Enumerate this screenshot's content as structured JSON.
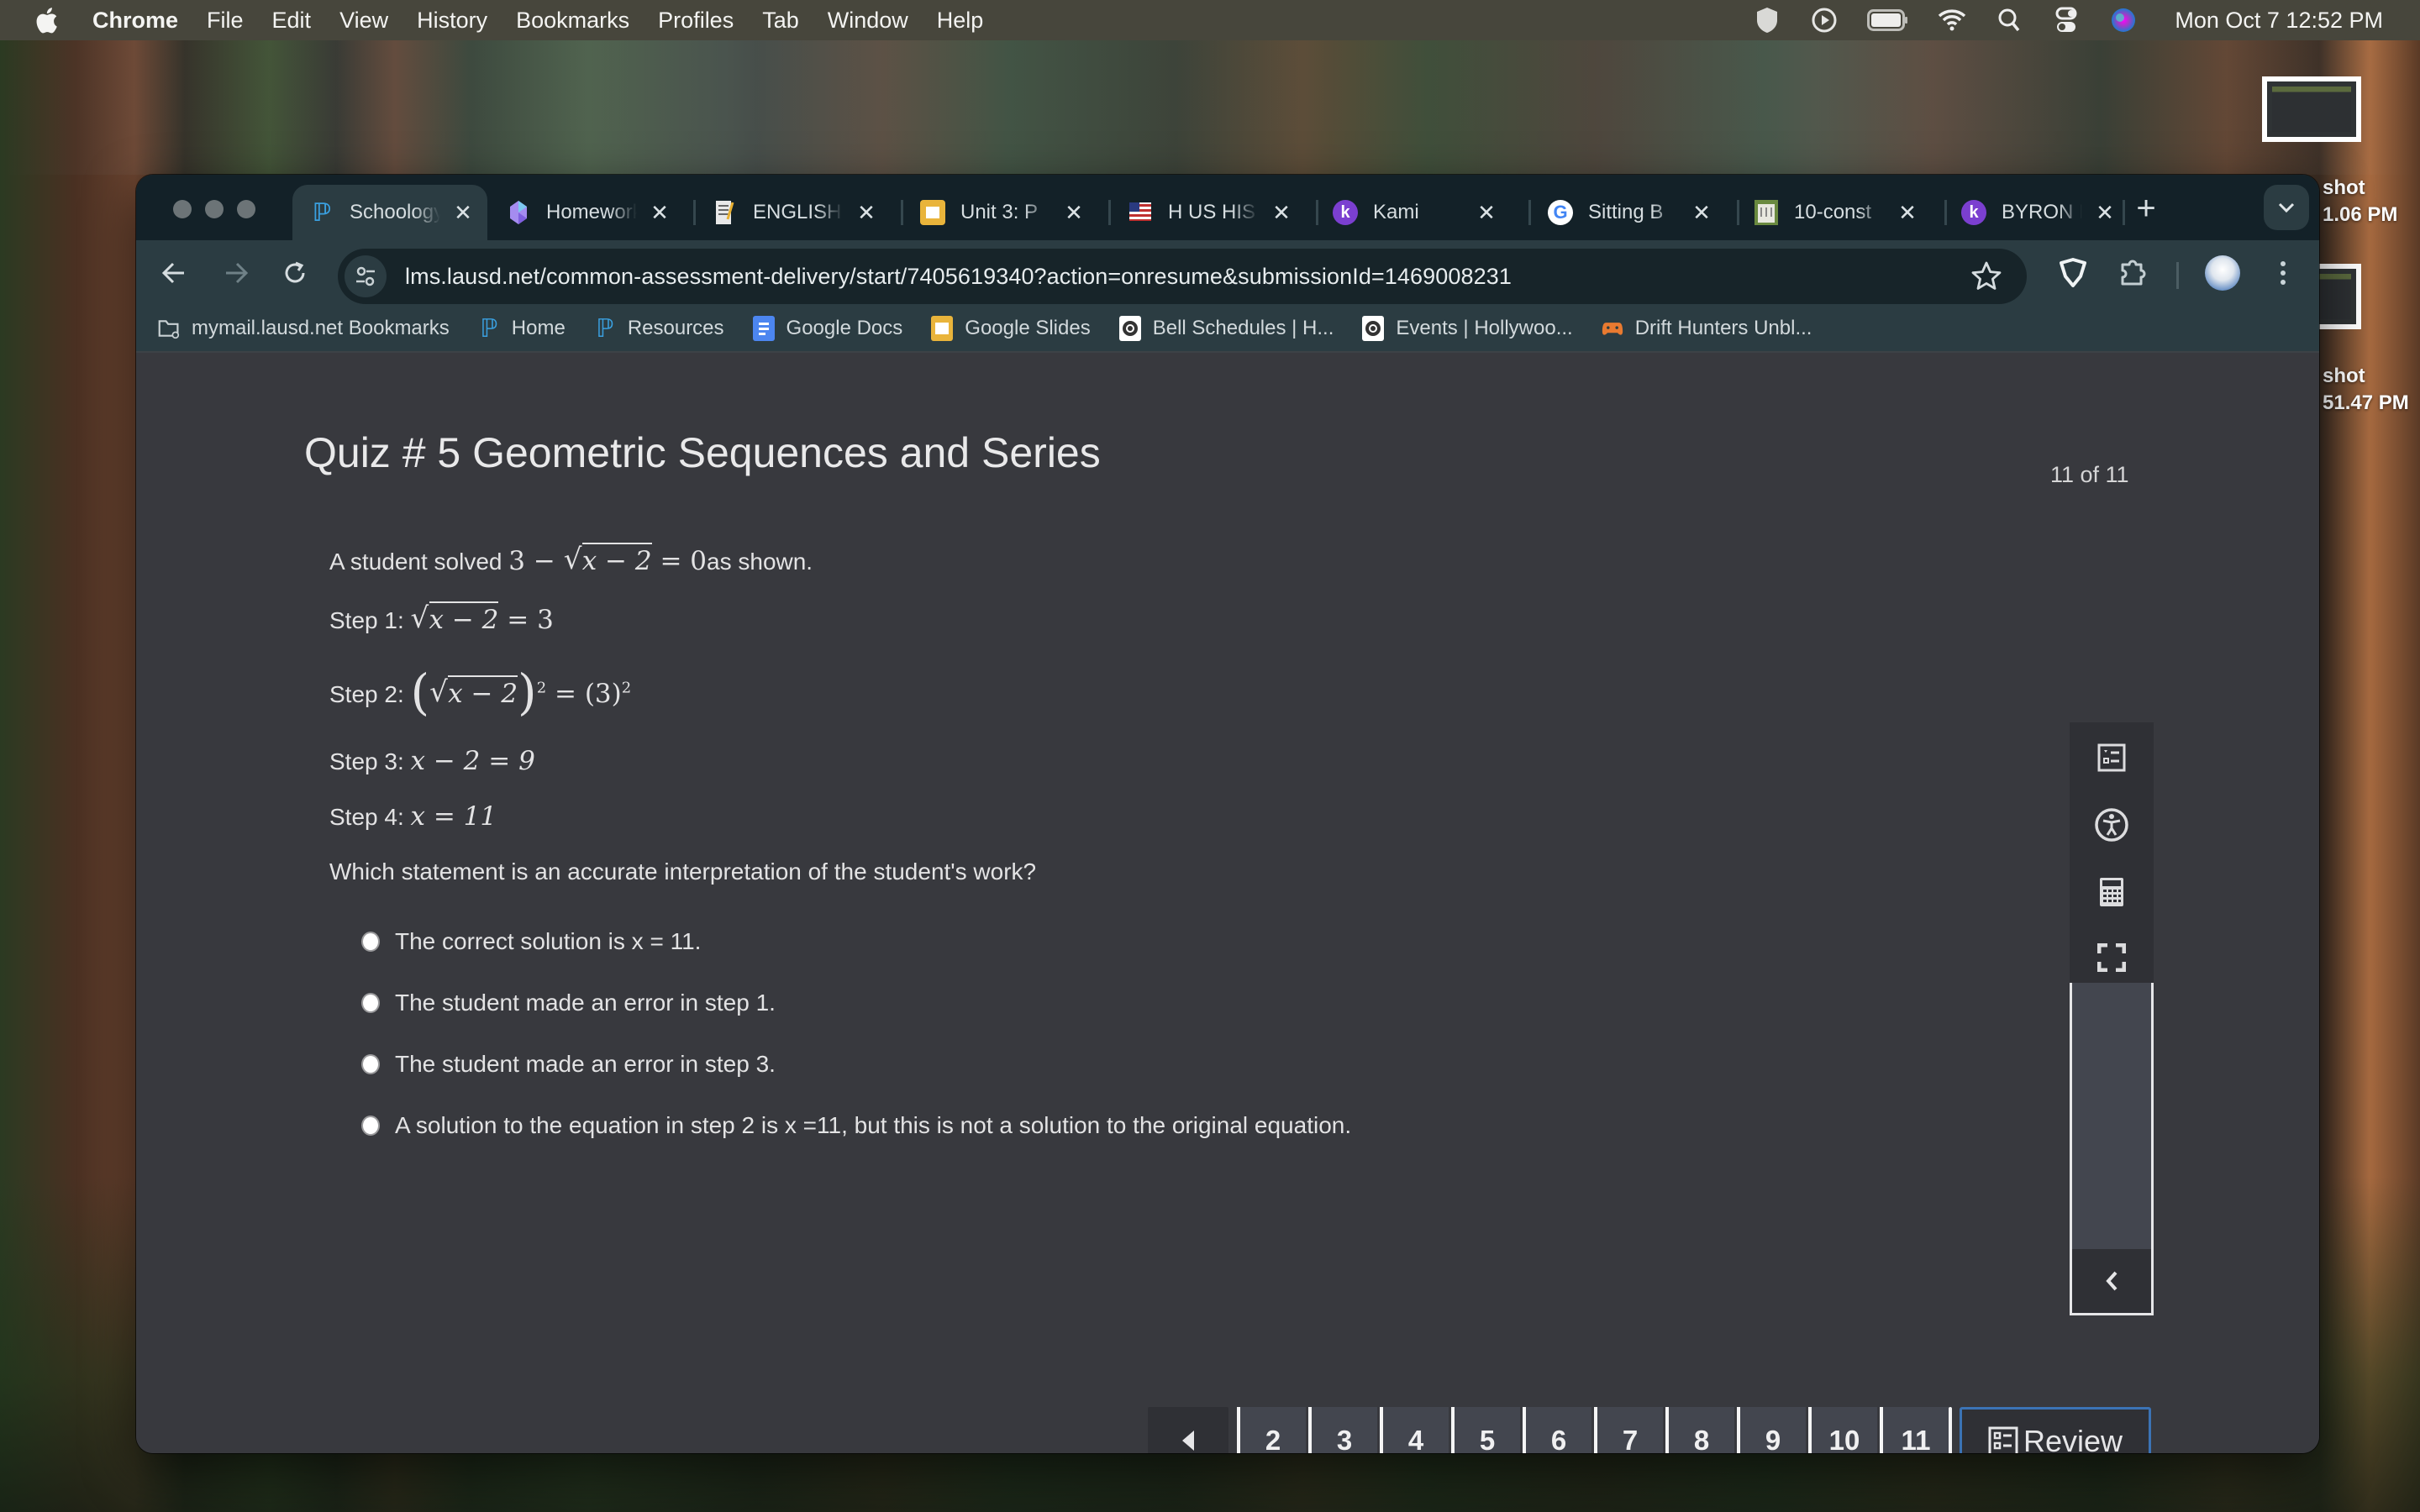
{
  "menubar": {
    "app_name": "Chrome",
    "items": [
      "File",
      "Edit",
      "View",
      "History",
      "Bookmarks",
      "Profiles",
      "Tab",
      "Window",
      "Help"
    ],
    "status_icons": [
      "shield-icon",
      "play-circle-icon",
      "battery-icon",
      "wifi-icon",
      "spotlight-search-icon",
      "control-center-icon",
      "siri-icon"
    ],
    "clock": "Mon Oct 7  12:52 PM"
  },
  "desktop": {
    "screenshot_labels": [
      {
        "line1": "shot",
        "line2": "1.06 PM"
      },
      {
        "line1": "shot",
        "line2": "51.47 PM"
      }
    ]
  },
  "browser": {
    "tabs": [
      {
        "title": "Schoology",
        "icon": "schoology-icon",
        "active": true
      },
      {
        "title": "Homework",
        "icon": "gem-icon",
        "active": false
      },
      {
        "title": "ENGLISH",
        "icon": "notepad-icon",
        "active": false
      },
      {
        "title": "Unit 3: P",
        "icon": "google-slides-icon",
        "active": false
      },
      {
        "title": "H US HIS",
        "icon": "us-flag-icon",
        "active": false
      },
      {
        "title": "Kami",
        "icon": "kami-icon",
        "active": false
      },
      {
        "title": "Sitting B",
        "icon": "google-icon",
        "active": false
      },
      {
        "title": "10-const",
        "icon": "courthouse-icon",
        "active": false
      },
      {
        "title": "BYRON F",
        "icon": "kami-icon",
        "active": false
      }
    ],
    "tab_close_glyph": "✕",
    "new_tab_glyph": "+",
    "url": "lms.lausd.net/common-assessment-delivery/start/7405619340?action=onresume&submissionId=1469008231",
    "bookmarks": [
      {
        "label": "mymail.lausd.net Bookmarks",
        "icon": "folder-icon"
      },
      {
        "label": "Home",
        "icon": "schoology-icon"
      },
      {
        "label": "Resources",
        "icon": "schoology-icon"
      },
      {
        "label": "Google Docs",
        "icon": "google-docs-icon"
      },
      {
        "label": "Google Slides",
        "icon": "google-slides-icon"
      },
      {
        "label": "Bell Schedules | H...",
        "icon": "school-seal-icon"
      },
      {
        "label": "Events | Hollywoo...",
        "icon": "school-seal-icon"
      },
      {
        "label": "Drift Hunters Unbl...",
        "icon": "gamepad-icon"
      }
    ]
  },
  "quiz": {
    "title": "Quiz # 5 Geometric Sequences and Series",
    "counter": "11 of 11",
    "prompt_prefix": "A student solved ",
    "prompt_math": {
      "a": "3",
      "op": "−",
      "radicand": "x − 2",
      "rhs": "= 0"
    },
    "prompt_suffix": "as shown.",
    "steps": [
      {
        "label": "Step 1: ",
        "radicand": "x − 2",
        "rhs": "= 3"
      },
      {
        "label": "Step 2: ",
        "radicand": "x − 2",
        "exp": "2",
        "rhs": "= (3)",
        "rhs_exp": "2"
      },
      {
        "label": "Step 3: ",
        "expr": "x − 2 = 9"
      },
      {
        "label": "Step 4: ",
        "expr": "x = 11"
      }
    ],
    "question": "Which statement is an accurate interpretation of the student's work?",
    "options": [
      "The correct solution is x = 11.",
      "The student made an error in step 1.",
      "The student made an error in step 3.",
      "A solution to the equation in step 2 is x =11, but this is not a solution to the original equation."
    ],
    "selected_option": null,
    "tools": [
      "review-list-icon",
      "accessibility-icon",
      "calculator-icon",
      "fullscreen-icon"
    ],
    "pagination": {
      "pages": [
        {
          "n": "2",
          "answered": true
        },
        {
          "n": "3",
          "answered": true
        },
        {
          "n": "4",
          "answered": true
        },
        {
          "n": "5",
          "answered": true
        },
        {
          "n": "6",
          "answered": true
        },
        {
          "n": "7",
          "answered": true
        },
        {
          "n": "8",
          "answered": false
        },
        {
          "n": "9",
          "answered": true
        },
        {
          "n": "10",
          "answered": false
        },
        {
          "n": "11",
          "answered": false,
          "current": true
        }
      ],
      "review_label": "Review"
    },
    "colors": {
      "accent": "#3b73b5",
      "answered_bar": "#6b6b6d",
      "page_bg": "#38393e"
    }
  }
}
